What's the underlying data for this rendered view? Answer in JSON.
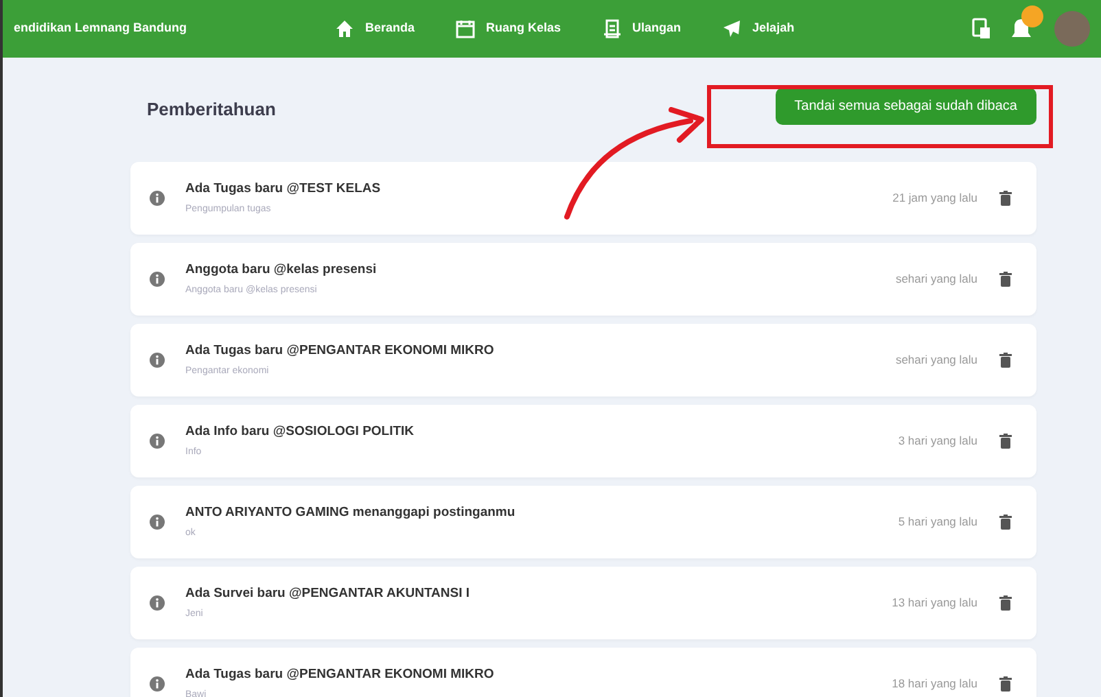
{
  "navbar": {
    "brand": "endidikan Lemnang Bandung",
    "links": [
      {
        "label": "Beranda",
        "selected": false
      },
      {
        "label": "Ruang Kelas",
        "selected": false
      },
      {
        "label": "Ulangan",
        "selected": false
      },
      {
        "label": "Jelajah",
        "selected": false
      }
    ]
  },
  "heading": "Pemberitahuan",
  "mark_all_button": "Tandai semua sebagai sudah dibaca",
  "notifications": [
    {
      "title": "Ada Tugas baru @TEST KELAS",
      "subtitle": "Pengumpulan tugas",
      "time": "21 jam yang lalu"
    },
    {
      "title": "Anggota baru @kelas presensi",
      "subtitle": "Anggota baru @kelas presensi",
      "time": "sehari yang lalu"
    },
    {
      "title": "Ada Tugas baru @PENGANTAR EKONOMI MIKRO",
      "subtitle": "Pengantar ekonomi",
      "time": "sehari yang lalu"
    },
    {
      "title": "Ada Info baru @SOSIOLOGI POLITIK",
      "subtitle": "Info",
      "time": "3 hari yang lalu"
    },
    {
      "title": "ANTO ARIYANTO GAMING menanggapi postinganmu",
      "subtitle": "ok",
      "time": "5 hari yang lalu"
    },
    {
      "title": "Ada Survei baru @PENGANTAR AKUNTANSI I",
      "subtitle": "Jeni",
      "time": "13 hari yang lalu"
    },
    {
      "title": "Ada Tugas baru @PENGANTAR EKONOMI MIKRO",
      "subtitle": "Bawi",
      "time": "18 hari yang lalu"
    }
  ]
}
